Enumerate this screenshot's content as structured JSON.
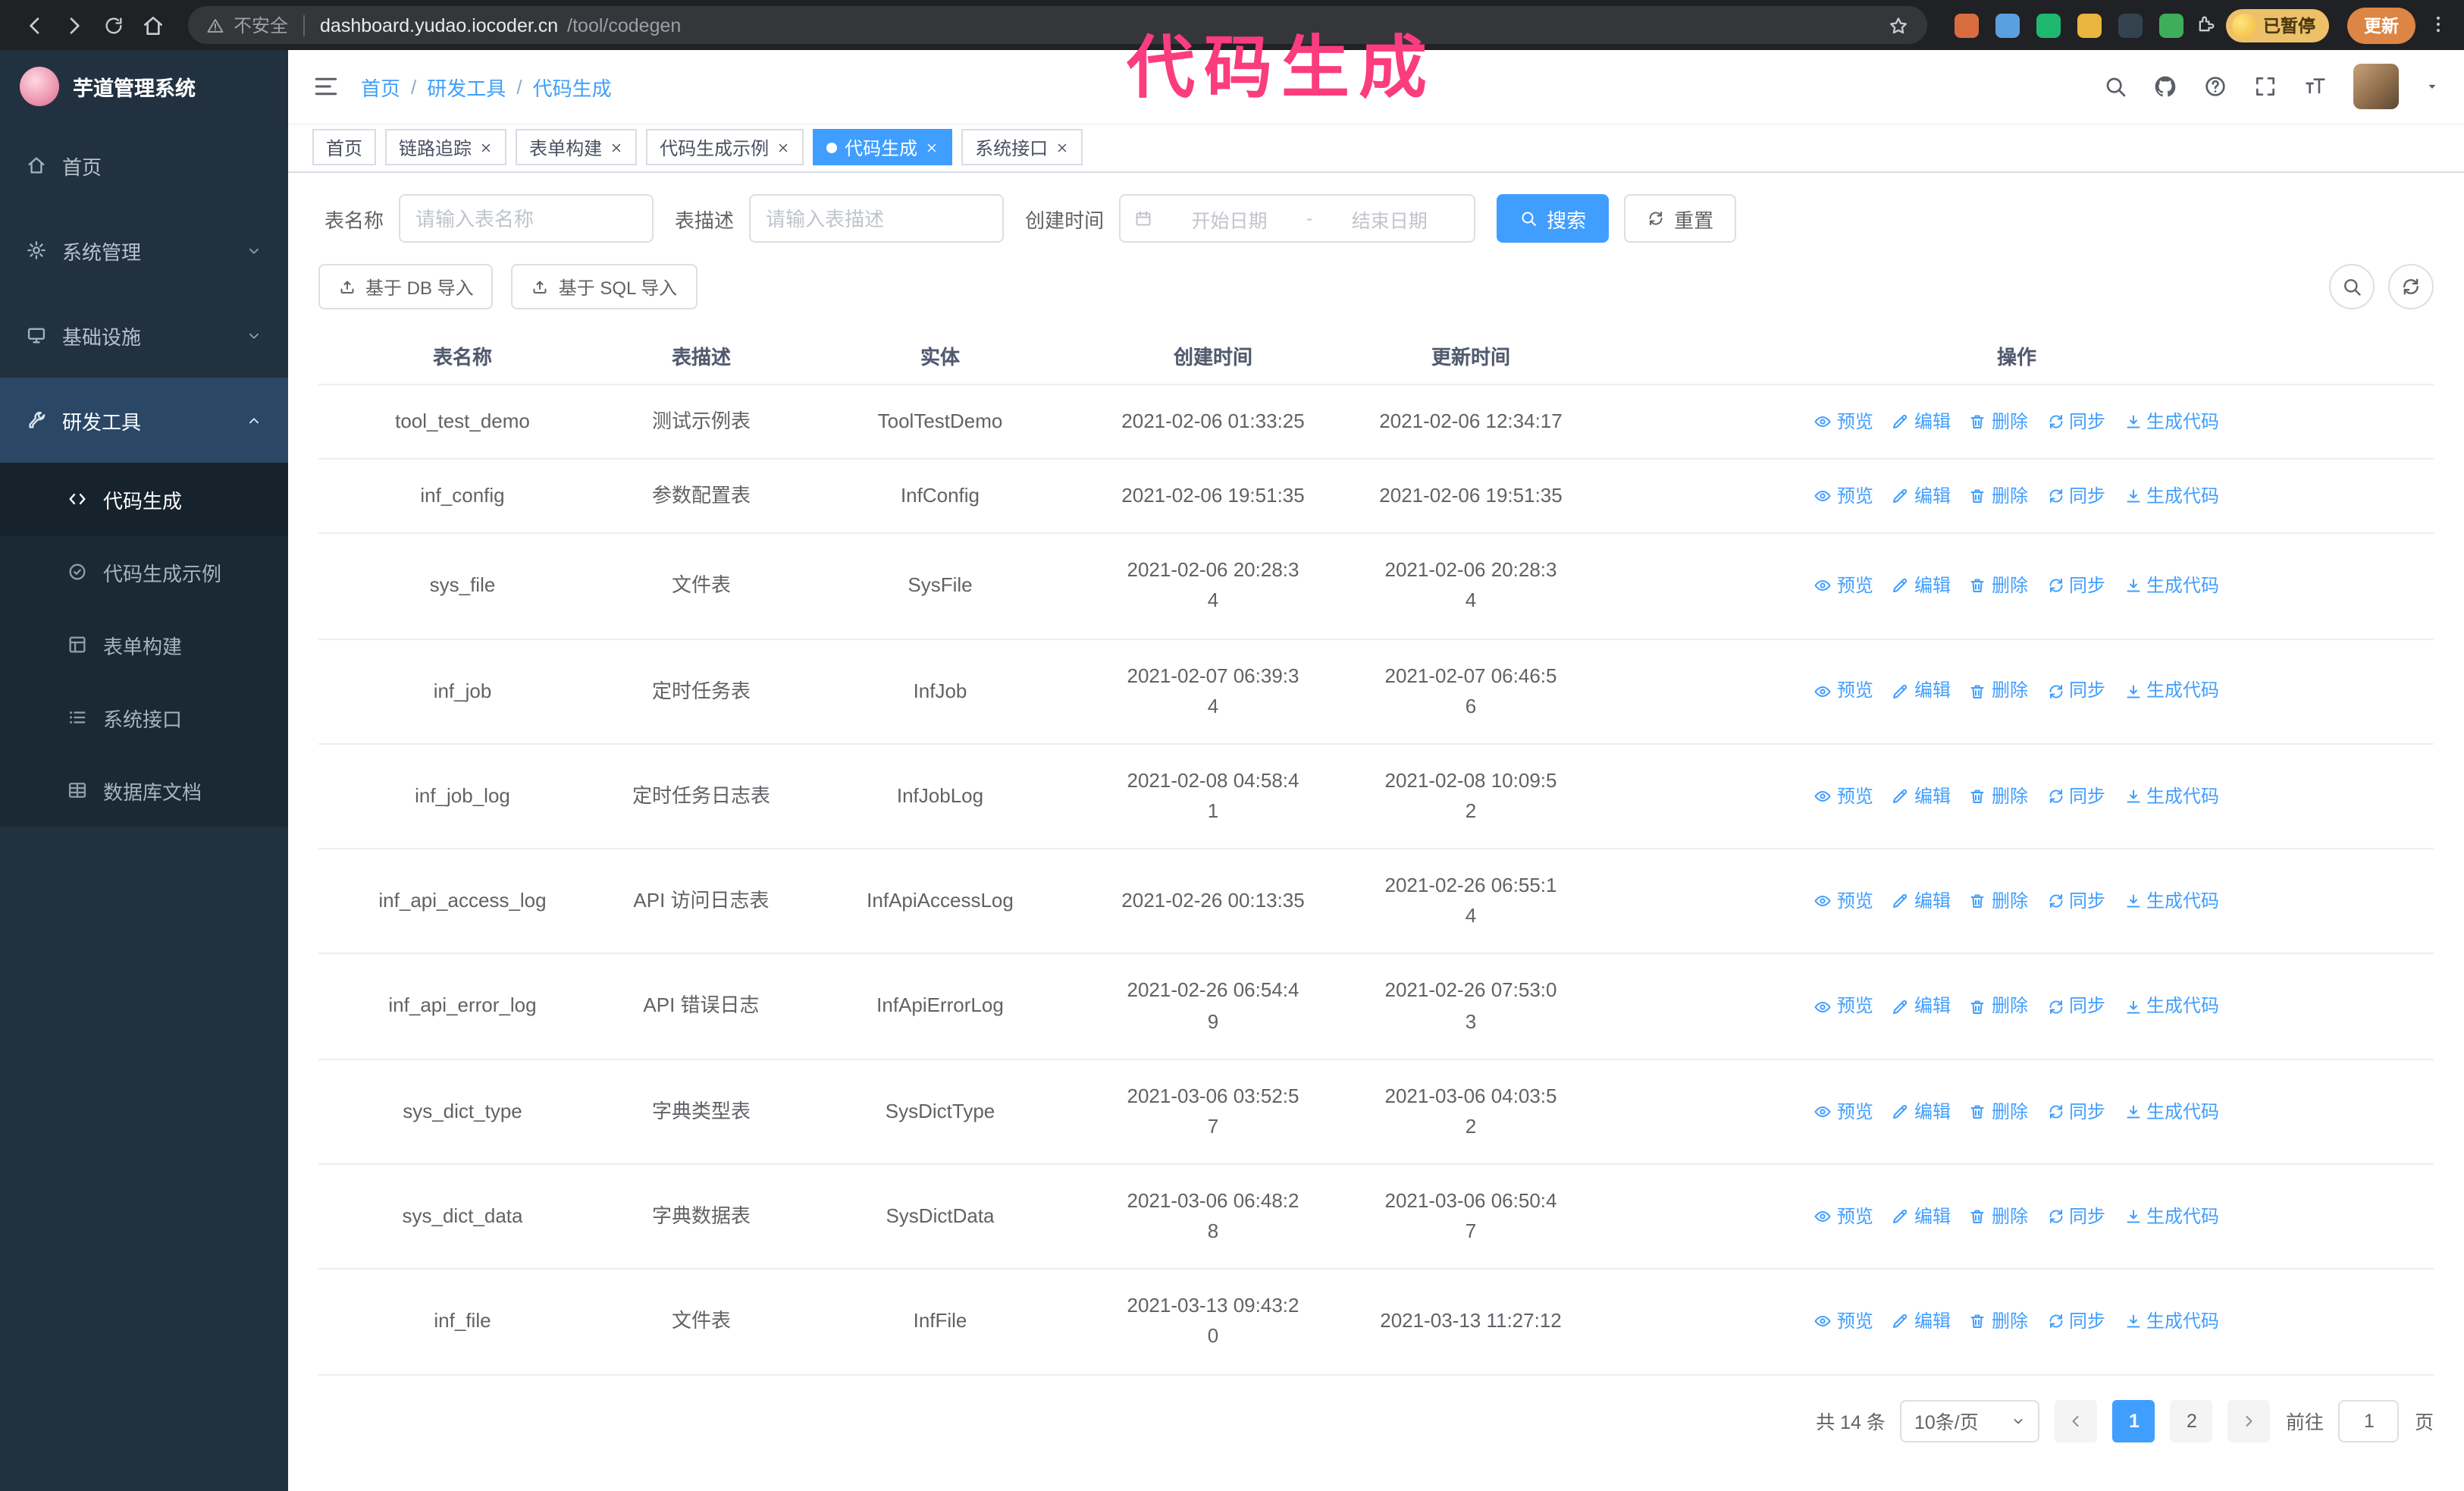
{
  "annotation": {
    "text": "代码生成",
    "color": "#fb3c7f"
  },
  "browser": {
    "security_label": "不安全",
    "url_host": "dashboard.yudao.iocoder.cn",
    "url_path": "/tool/codegen",
    "paused_badge": "已暂停",
    "update_label": "更新",
    "extensions": [
      {
        "name": "extension-orange",
        "color": "#d96c3f"
      },
      {
        "name": "extension-blue",
        "color": "#5a9fe0"
      },
      {
        "name": "extension-green-circle",
        "color": "#1fb76f"
      },
      {
        "name": "extension-multicolor",
        "color": "#e8b63c"
      },
      {
        "name": "extension-dark",
        "color": "#33424f"
      },
      {
        "name": "extension-leaf",
        "color": "#3fae5a"
      }
    ]
  },
  "sidebar": {
    "logo_title": "芋道管理系统",
    "items": [
      {
        "id": "home",
        "label": "首页",
        "icon": "home",
        "type": "top"
      },
      {
        "id": "system-management",
        "label": "系统管理",
        "icon": "gear",
        "type": "top",
        "chevron": "down"
      },
      {
        "id": "infrastructure",
        "label": "基础设施",
        "icon": "monitor",
        "type": "top",
        "chevron": "down"
      },
      {
        "id": "dev-tools",
        "label": "研发工具",
        "icon": "wrench",
        "type": "top",
        "chevron": "up",
        "active": true
      },
      {
        "id": "codegen",
        "label": "代码生成",
        "icon": "code",
        "type": "sub",
        "active": true
      },
      {
        "id": "codegen-example",
        "label": "代码生成示例",
        "icon": "badge",
        "type": "sub"
      },
      {
        "id": "form-builder",
        "label": "表单构建",
        "icon": "form",
        "type": "sub"
      },
      {
        "id": "system-api",
        "label": "系统接口",
        "icon": "api",
        "type": "sub"
      },
      {
        "id": "db-doc",
        "label": "数据库文档",
        "icon": "db",
        "type": "sub"
      }
    ]
  },
  "header": {
    "breadcrumb": [
      "首页",
      "研发工具",
      "代码生成"
    ]
  },
  "tabs": [
    {
      "label": "首页",
      "closable": false
    },
    {
      "label": "链路追踪",
      "closable": true
    },
    {
      "label": "表单构建",
      "closable": true
    },
    {
      "label": "代码生成示例",
      "closable": true
    },
    {
      "label": "代码生成",
      "closable": true,
      "active": true
    },
    {
      "label": "系统接口",
      "closable": true
    }
  ],
  "filters": {
    "table_name_label": "表名称",
    "table_name_placeholder": "请输入表名称",
    "table_desc_label": "表描述",
    "table_desc_placeholder": "请输入表描述",
    "create_time_label": "创建时间",
    "date_start_placeholder": "开始日期",
    "date_separator": "-",
    "date_end_placeholder": "结束日期",
    "search_label": "搜索",
    "reset_label": "重置"
  },
  "toolbar": {
    "import_db_label": "基于 DB 导入",
    "import_sql_label": "基于 SQL 导入"
  },
  "table": {
    "columns": [
      "表名称",
      "表描述",
      "实体",
      "创建时间",
      "更新时间",
      "操作"
    ],
    "actions": [
      {
        "id": "preview",
        "icon": "eye",
        "label": "预览"
      },
      {
        "id": "edit",
        "icon": "edit",
        "label": "编辑"
      },
      {
        "id": "delete",
        "icon": "trash",
        "label": "删除"
      },
      {
        "id": "sync",
        "icon": "refresh",
        "label": "同步"
      },
      {
        "id": "generate-code",
        "icon": "download",
        "label": "生成代码"
      }
    ],
    "rows": [
      {
        "name": "tool_test_demo",
        "desc": "测试示例表",
        "entity": "ToolTestDemo",
        "created": "2021-02-06 01:33:25",
        "updated": "2021-02-06 12:34:17"
      },
      {
        "name": "inf_config",
        "desc": "参数配置表",
        "entity": "InfConfig",
        "created": "2021-02-06 19:51:35",
        "updated": "2021-02-06 19:51:35"
      },
      {
        "name": "sys_file",
        "desc": "文件表",
        "entity": "SysFile",
        "created": "2021-02-06 20:28:3\n4",
        "updated": "2021-02-06 20:28:3\n4"
      },
      {
        "name": "inf_job",
        "desc": "定时任务表",
        "entity": "InfJob",
        "created": "2021-02-07 06:39:3\n4",
        "updated": "2021-02-07 06:46:5\n6"
      },
      {
        "name": "inf_job_log",
        "desc": "定时任务日志表",
        "entity": "InfJobLog",
        "created": "2021-02-08 04:58:4\n1",
        "updated": "2021-02-08 10:09:5\n2"
      },
      {
        "name": "inf_api_access_log",
        "desc": "API 访问日志表",
        "entity": "InfApiAccessLog",
        "created": "2021-02-26 00:13:35",
        "updated": "2021-02-26 06:55:1\n4"
      },
      {
        "name": "inf_api_error_log",
        "desc": "API 错误日志",
        "entity": "InfApiErrorLog",
        "created": "2021-02-26 06:54:4\n9",
        "updated": "2021-02-26 07:53:0\n3"
      },
      {
        "name": "sys_dict_type",
        "desc": "字典类型表",
        "entity": "SysDictType",
        "created": "2021-03-06 03:52:5\n7",
        "updated": "2021-03-06 04:03:5\n2"
      },
      {
        "name": "sys_dict_data",
        "desc": "字典数据表",
        "entity": "SysDictData",
        "created": "2021-03-06 06:48:2\n8",
        "updated": "2021-03-06 06:50:4\n7"
      },
      {
        "name": "inf_file",
        "desc": "文件表",
        "entity": "InfFile",
        "created": "2021-03-13 09:43:2\n0",
        "updated": "2021-03-13 11:27:12"
      }
    ]
  },
  "pagination": {
    "total_text": "共 14 条",
    "page_size_value": "10条/页",
    "pages": [
      "1",
      "2"
    ],
    "active_page": "1",
    "goto_label": "前往",
    "goto_value": "1",
    "page_unit": "页"
  }
}
